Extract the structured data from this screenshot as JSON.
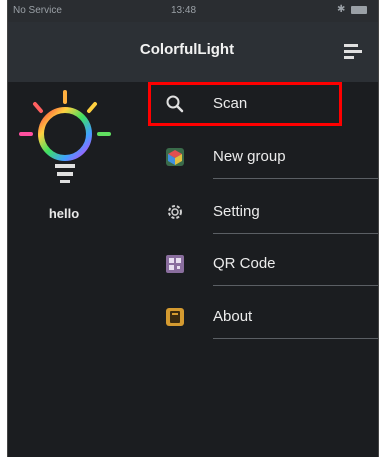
{
  "status_bar": {
    "carrier": "No Service",
    "time": "13:48"
  },
  "header": {
    "title": "ColorfulLight"
  },
  "device": {
    "name": "hello"
  },
  "menu": {
    "items": [
      {
        "label": "Scan",
        "icon": "search-icon"
      },
      {
        "label": "New group",
        "icon": "cube-icon"
      },
      {
        "label": "Setting",
        "icon": "gear-icon"
      },
      {
        "label": "QR Code",
        "icon": "qr-code-icon"
      },
      {
        "label": "About",
        "icon": "info-book-icon"
      }
    ]
  },
  "colors": {
    "background": "#1b1d20",
    "header": "#2c3035",
    "highlight": "#ff0000",
    "text": "#ececec"
  }
}
